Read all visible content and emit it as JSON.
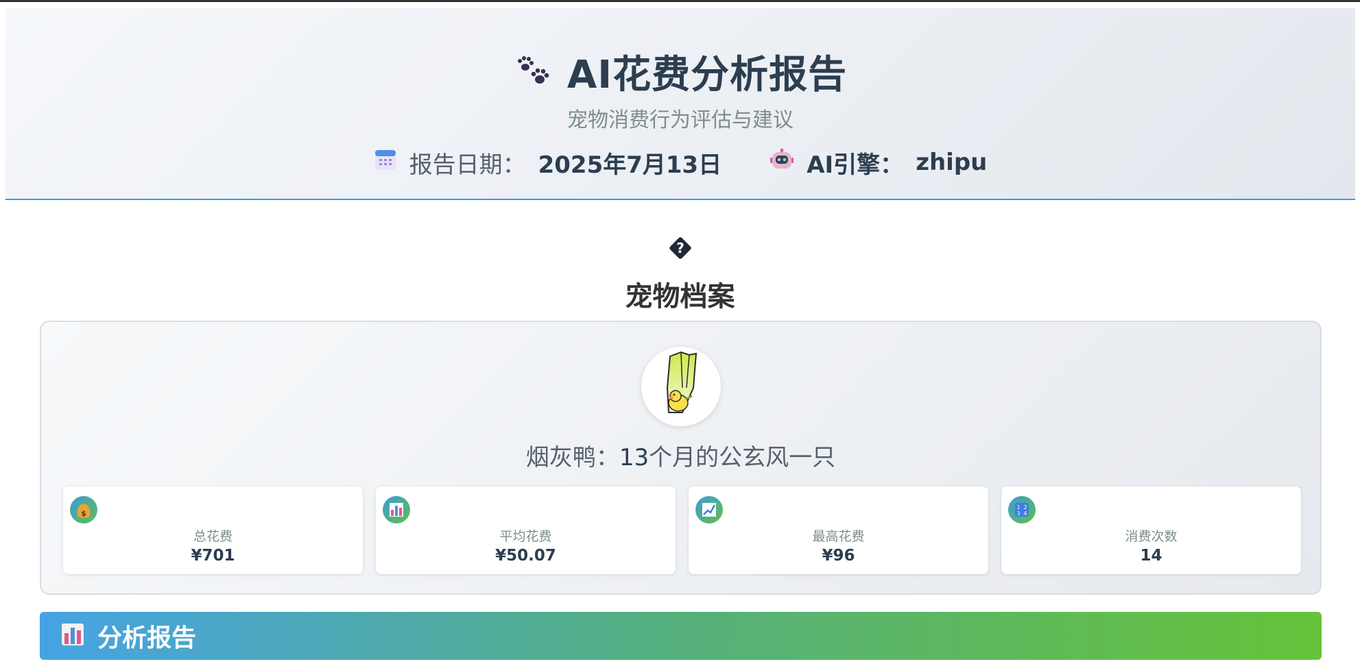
{
  "header": {
    "title": "AI花费分析报告",
    "subtitle": "宠物消费行为评估与建议",
    "date_label": "报告日期：",
    "date_value": "2025年7月13日",
    "engine_label": "AI引擎：",
    "engine_value": "zhipu",
    "icons": [
      "paw-prints-icon",
      "calendar-icon",
      "robot-icon"
    ]
  },
  "profile_section": {
    "title": "宠物档案",
    "icon": "question-diamond-icon",
    "pet_name": "烟灰鸭：",
    "pet_age": "13",
    "pet_detail": "个月的公玄风一只",
    "avatar": "cockatiel-cartoon-avatar"
  },
  "stats": [
    {
      "icon": "money-bag-icon",
      "label": "总花费",
      "value": "¥701"
    },
    {
      "icon": "bar-chart-icon",
      "label": "平均花费",
      "value": "¥50.07"
    },
    {
      "icon": "chart-increasing-icon",
      "label": "最高花费",
      "value": "¥96"
    },
    {
      "icon": "numbers-1234-icon",
      "label": "消费次数",
      "value": "14"
    }
  ],
  "analysis": {
    "title": "分析报告",
    "icon": "bar-chart-icon"
  },
  "colors": {
    "header_border": "#3a9bdc",
    "bar_gradient_start": "#46a3e4",
    "bar_gradient_end": "#66c33a",
    "title_text": "#2c3e50"
  }
}
